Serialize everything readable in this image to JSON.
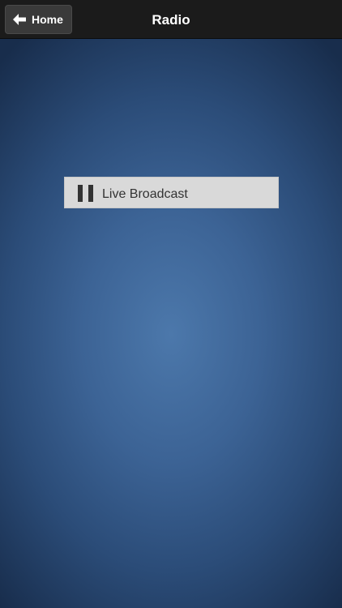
{
  "nav": {
    "back_label": "Home",
    "title": "Radio"
  },
  "player": {
    "state": "playing",
    "label": "Live Broadcast"
  },
  "icons": {
    "back": "arrow-left-icon",
    "pause": "pause-icon"
  },
  "colors": {
    "nav_bg": "#1b1b1b",
    "background_center": "#4c78ab",
    "background_edge": "#182d4c",
    "player_bg": "#d9d9d9",
    "player_text": "#333333"
  }
}
